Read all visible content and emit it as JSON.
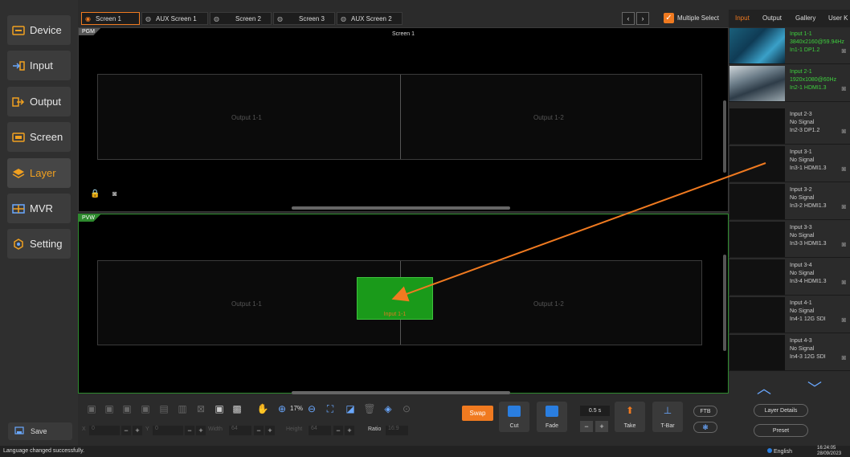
{
  "sidebar": {
    "items": [
      {
        "label": "Device",
        "icon": "device-icon"
      },
      {
        "label": "Input",
        "icon": "input-icon"
      },
      {
        "label": "Output",
        "icon": "output-icon"
      },
      {
        "label": "Screen",
        "icon": "screen-icon"
      },
      {
        "label": "Layer",
        "icon": "layer-icon",
        "active": true
      },
      {
        "label": "MVR",
        "icon": "mvr-icon"
      },
      {
        "label": "Setting",
        "icon": "setting-icon"
      }
    ],
    "save_label": "Save"
  },
  "tabs": {
    "items": [
      "Screen 1",
      "AUX Screen 1",
      "Screen 2",
      "Screen 3",
      "AUX Screen 2"
    ],
    "multiple_select_label": "Multiple Select",
    "multiple_select_checked": true
  },
  "pgm": {
    "label": "PGM",
    "title": "Screen 1",
    "outputs": [
      "Output 1-1",
      "Output 1-2"
    ]
  },
  "pvw": {
    "label": "PVW",
    "outputs": [
      "Output 1-1",
      "Output 1-2"
    ],
    "layer_label": "Input 1-1"
  },
  "toolbar": {
    "zoom": "17%",
    "x_label": "X",
    "x_value": "0",
    "y_label": "Y",
    "y_value": "0",
    "width_label": "Width",
    "width_value": "64",
    "height_label": "Height",
    "height_value": "64",
    "ratio_label": "Ratio",
    "ratio_value": "16:9",
    "swap_label": "Swap",
    "cut_label": "Cut",
    "fade_label": "Fade",
    "duration": "0.5 s",
    "take_label": "Take",
    "tbar_label": "T-Bar",
    "ftb_label": "FTB"
  },
  "right_panel": {
    "tabs": [
      "Input",
      "Output",
      "Gallery",
      "User K"
    ],
    "active_tab": "Input",
    "inputs": [
      {
        "name": "Input 1-1",
        "info": "3840x2160@59.94Hz",
        "port": "In1-1  DP1.2",
        "active": true,
        "thumb": "circuit"
      },
      {
        "name": "Input 2-1",
        "info": "1920x1080@60Hz",
        "port": "In2-1  HDMI1.3",
        "active": true,
        "thumb": "snow"
      },
      {
        "name": "Input 2-3",
        "info": "No Signal",
        "port": "In2-3  DP1.2"
      },
      {
        "name": "Input 3-1",
        "info": "No Signal",
        "port": "In3-1  HDMI1.3"
      },
      {
        "name": "Input 3-2",
        "info": "No Signal",
        "port": "In3-2  HDMI1.3"
      },
      {
        "name": "Input 3-3",
        "info": "No Signal",
        "port": "In3-3  HDMI1.3"
      },
      {
        "name": "Input 3-4",
        "info": "No Signal",
        "port": "In3-4  HDMI1.3"
      },
      {
        "name": "Input 4-1",
        "info": "No Signal",
        "port": "In4-1  12G SDI"
      },
      {
        "name": "Input 4-3",
        "info": "No Signal",
        "port": "In4-3  12G SDI"
      }
    ],
    "layer_details_label": "Layer Details",
    "preset_label": "Preset"
  },
  "status": {
    "message": "Language changed successfully.",
    "language": "English",
    "time": "16:24:05",
    "date": "28/09/2023"
  },
  "colors": {
    "accent": "#f07a20",
    "active_green": "#3ed13e",
    "blue": "#2a7ee0"
  }
}
